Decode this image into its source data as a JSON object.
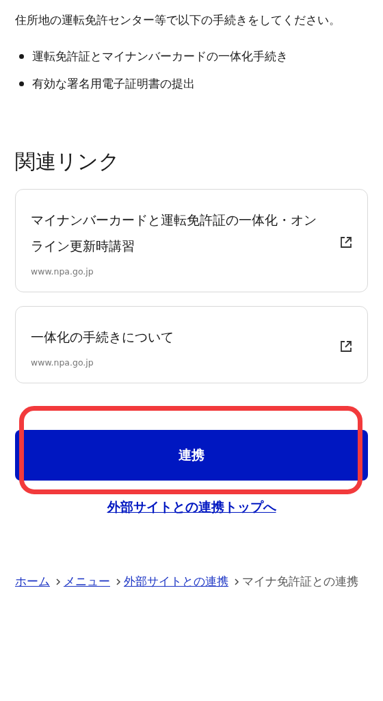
{
  "intro": {
    "text": "住所地の運転免許センター等で以下の手続きをしてください。",
    "items": [
      "運転免許証とマイナンバーカードの一体化手続き",
      "有効な署名用電子証明書の提出"
    ]
  },
  "related_links": {
    "heading": "関連リンク",
    "cards": [
      {
        "title": "マイナンバーカードと運転免許証の一体化・オンライン更新時講習",
        "domain": "www.npa.go.jp"
      },
      {
        "title": "一体化の手続きについて",
        "domain": "www.npa.go.jp"
      }
    ]
  },
  "primary_button": {
    "label": "連携",
    "highlighted": true
  },
  "top_link": "外部サイトとの連携トップへ",
  "breadcrumb": [
    {
      "kind": "link",
      "label": "ホーム"
    },
    {
      "kind": "link",
      "label": "メニュー"
    },
    {
      "kind": "link",
      "label": "外部サイトとの連携"
    },
    {
      "kind": "current",
      "label": "マイナ免許証との連携"
    }
  ]
}
